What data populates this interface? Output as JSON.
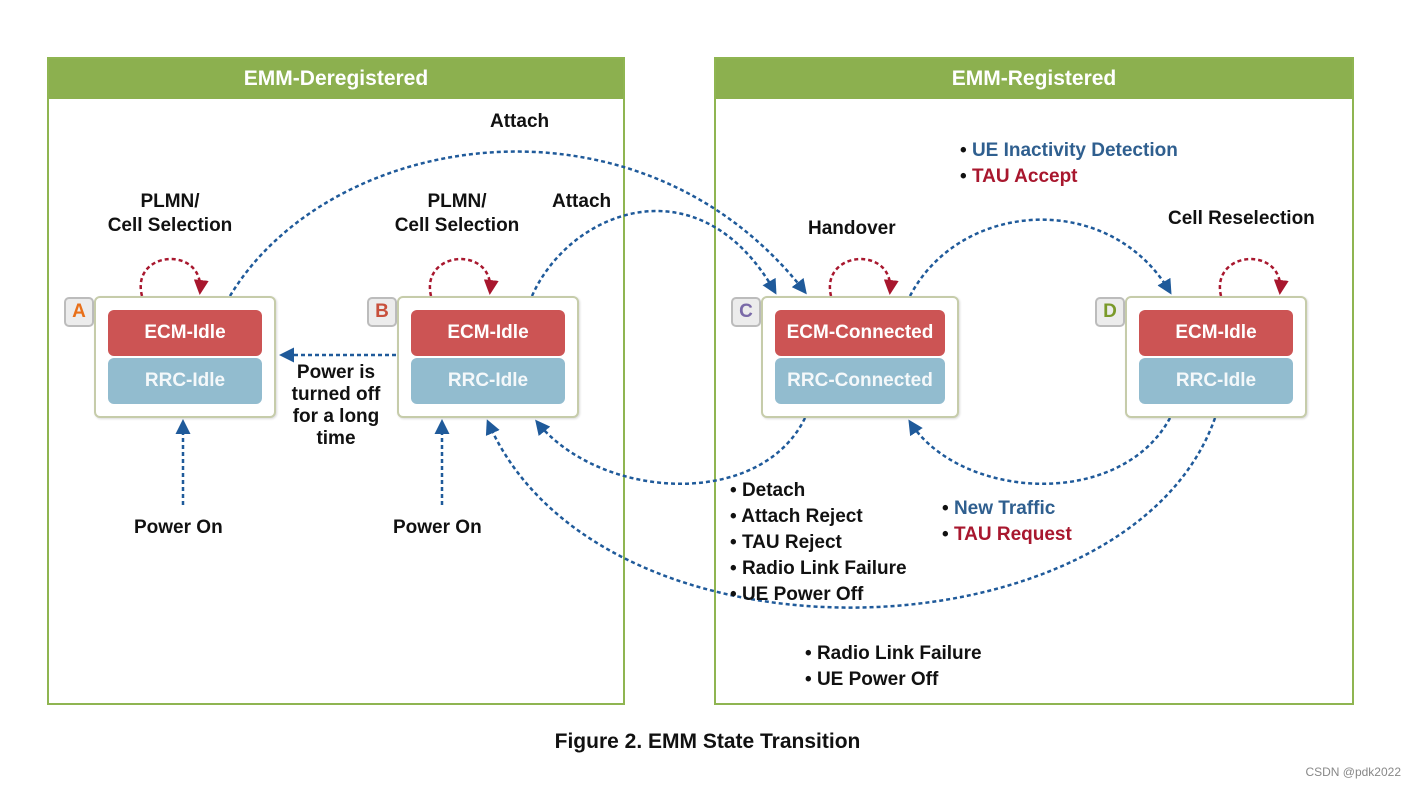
{
  "panels": {
    "deregistered": "EMM-Deregistered",
    "registered": "EMM-Registered"
  },
  "states": [
    {
      "letter": "A",
      "letter_color": "#e8701a",
      "ecm": "ECM-Idle",
      "rrc": "RRC-Idle"
    },
    {
      "letter": "B",
      "letter_color": "#c8503c",
      "ecm": "ECM-Idle",
      "rrc": "RRC-Idle"
    },
    {
      "letter": "C",
      "letter_color": "#7a6aa8",
      "ecm": "ECM-Connected",
      "rrc": "RRC-Connected"
    },
    {
      "letter": "D",
      "letter_color": "#7a9a2a",
      "ecm": "ECM-Idle",
      "rrc": "RRC-Idle"
    }
  ],
  "labels": {
    "attach_long": "Attach",
    "attach_short": "Attach",
    "plmn_a_1": "PLMN/",
    "plmn_a_2": "Cell Selection",
    "plmn_b_1": "PLMN/",
    "plmn_b_2": "Cell Selection",
    "handover": "Handover",
    "cell_reselection": "Cell Reselection",
    "power_on_a": "Power On",
    "power_on_b": "Power On",
    "power_off_1": "Power is",
    "power_off_2": "turned off",
    "power_off_3": "for a long",
    "power_off_4": "time"
  },
  "c_to_d_triggers": [
    {
      "text": "UE Inactivity Detection",
      "tone": "blue"
    },
    {
      "text": "TAU Accept",
      "tone": "red"
    }
  ],
  "d_to_c_triggers": [
    {
      "text": "New Traffic",
      "tone": "blue"
    },
    {
      "text": "TAU Request",
      "tone": "red"
    }
  ],
  "c_to_b_triggers": [
    "Detach",
    "Attach Reject",
    "TAU Reject",
    "Radio Link Failure",
    "UE Power Off"
  ],
  "d_to_b_triggers": [
    "Radio Link Failure",
    "UE Power Off"
  ],
  "caption": "Figure 2. EMM State Transition",
  "watermark": "CSDN @pdk2022",
  "colors": {
    "panel_header": "#8cb04f",
    "ecm_box": "#cc5454",
    "rrc_box": "#92bccf",
    "transition_arrow": "#1f5a9a",
    "self_loop_arrow": "#a8172e"
  }
}
